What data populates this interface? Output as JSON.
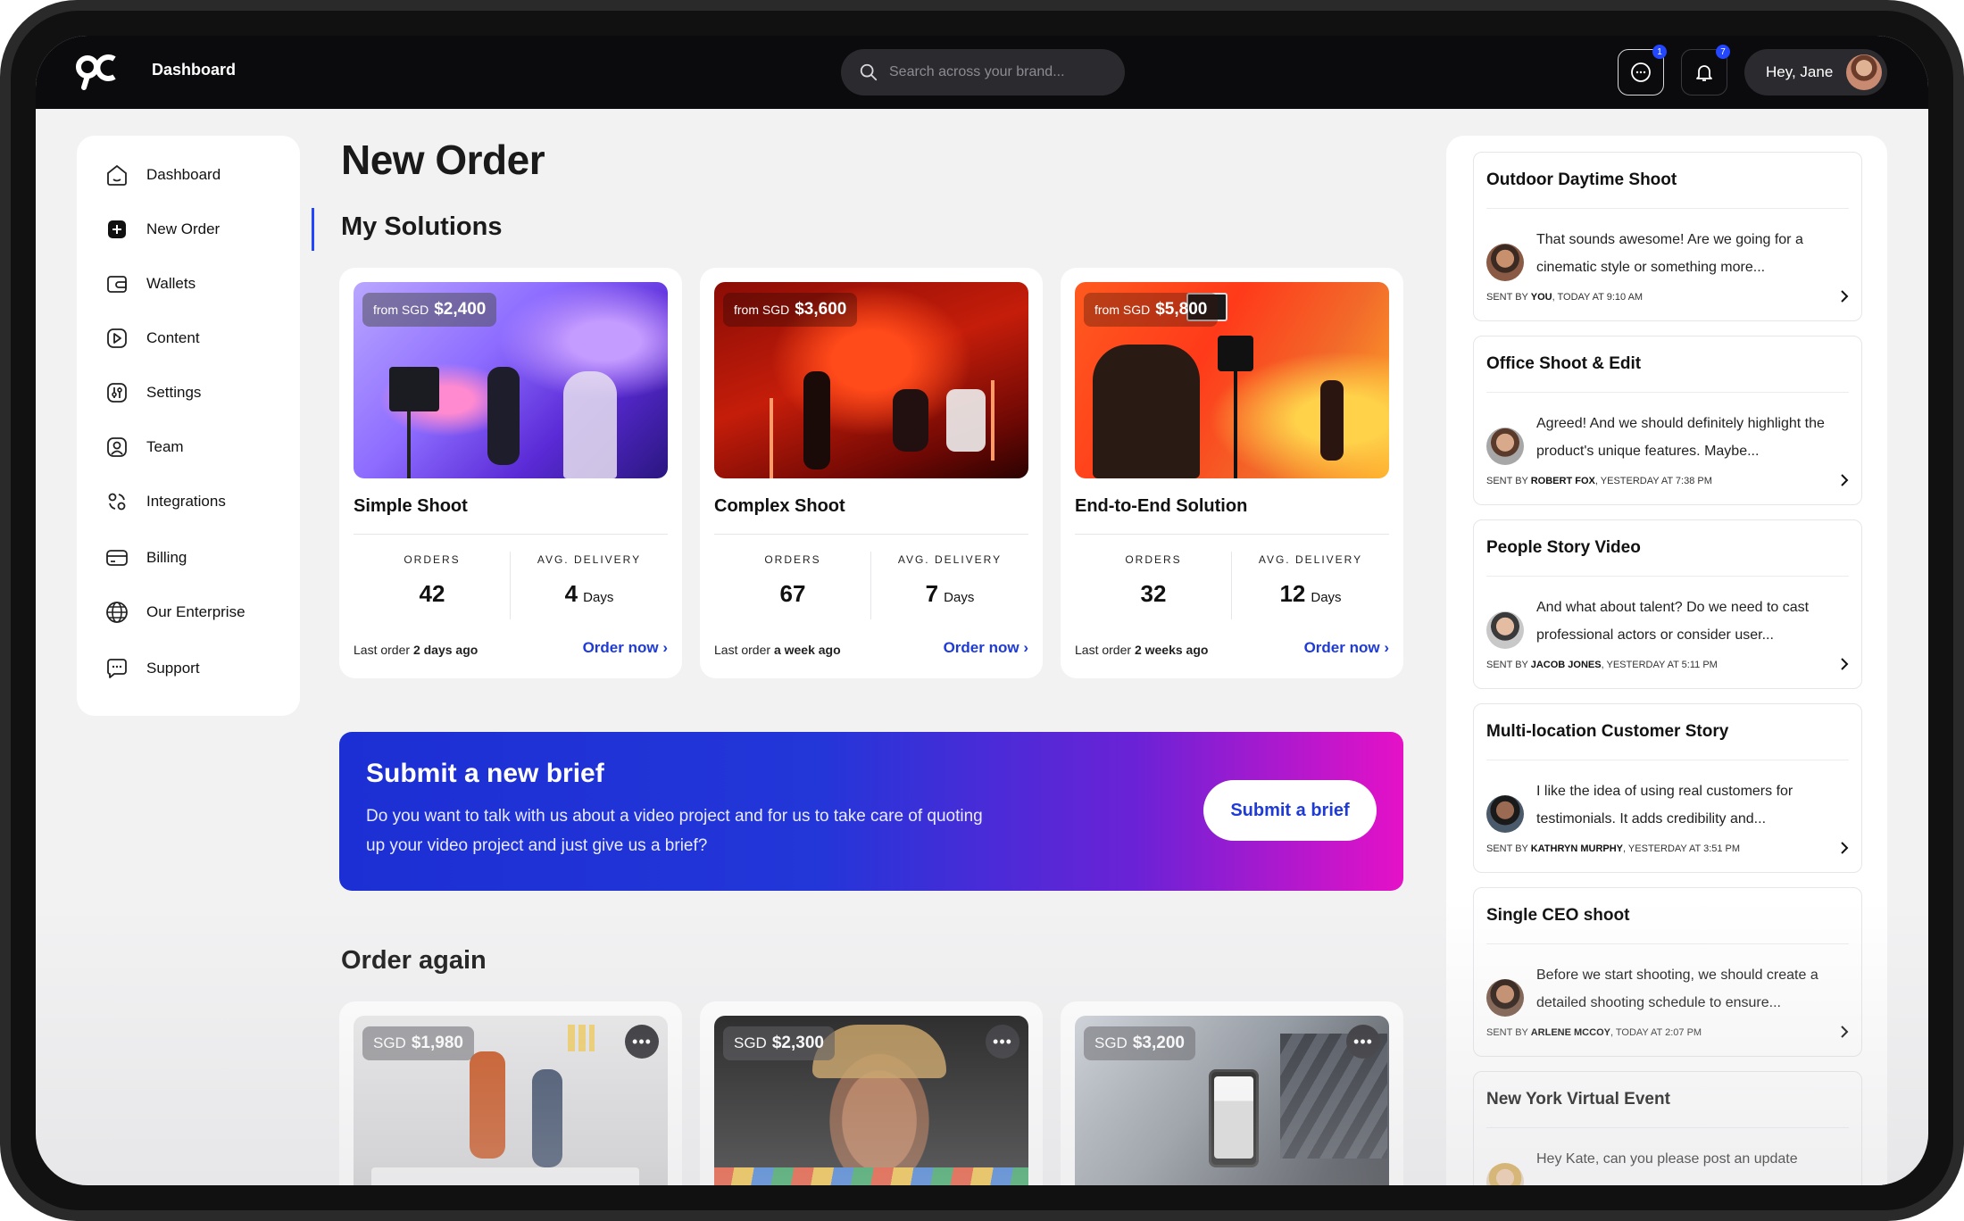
{
  "topbar": {
    "title": "Dashboard",
    "search_placeholder": "Search across your brand...",
    "chat_badge": "1",
    "bell_badge": "7",
    "user_greeting": "Hey, Jane"
  },
  "sidebar": {
    "items": [
      {
        "label": "Dashboard",
        "icon": "home-icon"
      },
      {
        "label": "New Order",
        "icon": "plus-square-icon"
      },
      {
        "label": "Wallets",
        "icon": "wallet-icon"
      },
      {
        "label": "Content",
        "icon": "play-icon"
      },
      {
        "label": "Settings",
        "icon": "sliders-icon"
      },
      {
        "label": "Team",
        "icon": "user-icon"
      },
      {
        "label": "Integrations",
        "icon": "integrations-icon"
      },
      {
        "label": "Billing",
        "icon": "credit-card-icon"
      },
      {
        "label": "Our Enterprise",
        "icon": "globe-icon"
      },
      {
        "label": "Support",
        "icon": "support-chat-icon"
      }
    ],
    "active": "New Order"
  },
  "main": {
    "title": "New Order",
    "solutions_heading": "My Solutions",
    "solutions": [
      {
        "from": "from SGD",
        "price": "$2,400",
        "title": "Simple Shoot",
        "orders_label": "ORDERS",
        "orders": "42",
        "delivery_label": "AVG. DELIVERY",
        "delivery": "4",
        "delivery_unit": "Days",
        "last_prefix": "Last order",
        "last_value": "2 days ago",
        "cta": "Order now"
      },
      {
        "from": "from SGD",
        "price": "$3,600",
        "title": "Complex Shoot",
        "orders_label": "ORDERS",
        "orders": "67",
        "delivery_label": "AVG. DELIVERY",
        "delivery": "7",
        "delivery_unit": "Days",
        "last_prefix": "Last order",
        "last_value": "a week ago",
        "cta": "Order now"
      },
      {
        "from": "from SGD",
        "price": "$5,800",
        "title": "End-to-End Solution",
        "orders_label": "ORDERS",
        "orders": "32",
        "delivery_label": "AVG. DELIVERY",
        "delivery": "12",
        "delivery_unit": "Days",
        "last_prefix": "Last order",
        "last_value": "2 weeks ago",
        "cta": "Order now"
      }
    ],
    "brief": {
      "title": "Submit a new brief",
      "description": "Do you want to talk with us about a video project and for us to take care of quoting up your video project and just give us a brief?",
      "button": "Submit a brief"
    },
    "order_again_heading": "Order again",
    "order_again": [
      {
        "currency": "SGD",
        "price": "$1,980"
      },
      {
        "currency": "SGD",
        "price": "$2,300"
      },
      {
        "currency": "SGD",
        "price": "$3,200"
      }
    ]
  },
  "messages": [
    {
      "title": "Outdoor Daytime Shoot",
      "text": "That sounds awesome! Are we going for a cinematic style or something more...",
      "sent_by_prefix": "SENT BY",
      "sender": "YOU",
      "time": ", TODAY AT 9:10 AM"
    },
    {
      "title": "Office Shoot & Edit",
      "text": "Agreed! And we should definitely highlight the product's unique features. Maybe...",
      "sent_by_prefix": "SENT BY",
      "sender": "ROBERT FOX",
      "time": ", YESTERDAY AT 7:38 PM"
    },
    {
      "title": "People Story Video",
      "text": "And what about talent? Do we need to cast professional actors or consider user...",
      "sent_by_prefix": "SENT BY",
      "sender": "JACOB JONES",
      "time": ", YESTERDAY AT 5:11 PM"
    },
    {
      "title": "Multi-location Customer Story",
      "text": "I like the idea of using real customers for testimonials. It adds credibility and...",
      "sent_by_prefix": "SENT BY",
      "sender": "KATHRYN MURPHY",
      "time": ", YESTERDAY AT 3:51 PM"
    },
    {
      "title": "Single CEO shoot",
      "text": "Before we start shooting, we should create a detailed shooting schedule to ensure...",
      "sent_by_prefix": "SENT BY",
      "sender": "ARLENE MCCOY",
      "time": ", TODAY AT 2:07 PM"
    },
    {
      "title": "New York Virtual Event",
      "text": "Hey Kate, can you please post an update",
      "sent_by_prefix": "",
      "sender": "",
      "time": ""
    }
  ],
  "colors": {
    "accent": "#1f3bd6",
    "topbar": "#0b0b0d",
    "banner_start": "#1c2fd4",
    "banner_end": "#e511c7"
  }
}
